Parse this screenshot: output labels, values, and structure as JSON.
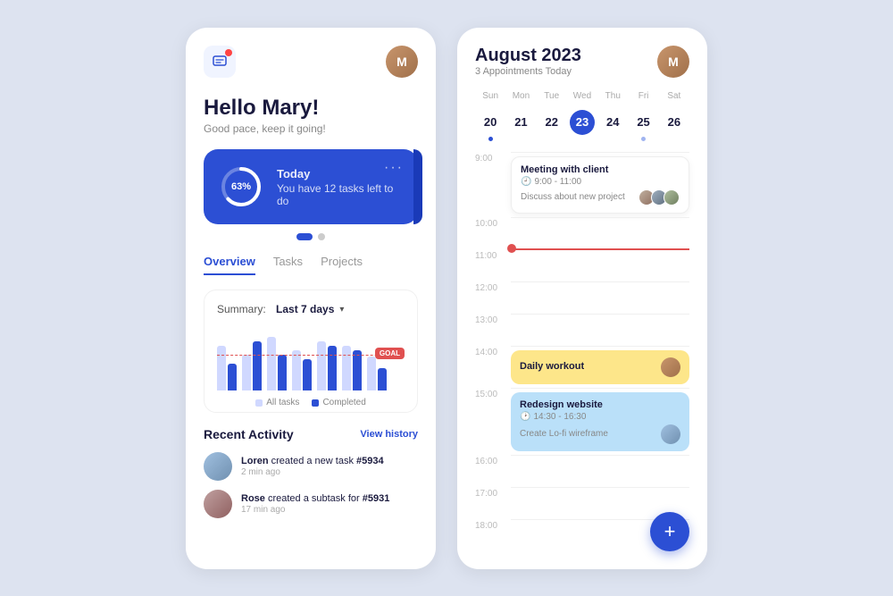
{
  "left": {
    "greeting": "Hello Mary!",
    "greeting_sub": "Good pace, keep it going!",
    "task_card": {
      "progress": 63,
      "progress_label": "63%",
      "day": "Today",
      "desc": "You have 12 tasks left to do",
      "dots_label": "..."
    },
    "tabs": [
      "Overview",
      "Tasks",
      "Projects"
    ],
    "summary": {
      "label": "Summary:",
      "period": "Last 7 days",
      "goal_label": "GOAL",
      "legend_all": "All tasks",
      "legend_completed": "Completed"
    },
    "recent": {
      "title": "Recent Activity",
      "view_history": "View history",
      "items": [
        {
          "user": "Loren",
          "action": "created a new task",
          "task": "#5934",
          "time": "2 min ago"
        },
        {
          "user": "Rose",
          "action": "created a subtask for",
          "task": "#5931",
          "time": "17 min ago"
        }
      ]
    }
  },
  "right": {
    "month": "August 2023",
    "appointments": "3 Appointments Today",
    "days": [
      "Sun",
      "Mon",
      "Tue",
      "Wed",
      "Thu",
      "Fri",
      "Sat"
    ],
    "dates": [
      {
        "num": "20",
        "dot": "blue"
      },
      {
        "num": "21",
        "dot": null
      },
      {
        "num": "22",
        "dot": null
      },
      {
        "num": "23",
        "dot": "blue",
        "today": true
      },
      {
        "num": "24",
        "dot": null
      },
      {
        "num": "25",
        "dot": "light"
      },
      {
        "num": "26",
        "dot": null
      }
    ],
    "timeline": [
      {
        "time": "9:00",
        "event": {
          "type": "white",
          "title": "Meeting with client",
          "time_range": "9:00 - 11:00",
          "desc": "Discuss about new project",
          "avatars": 3
        }
      },
      {
        "time": "10:00",
        "event": null
      },
      {
        "time": "11:00",
        "event": null
      },
      {
        "time": "12:00",
        "event": null
      },
      {
        "time": "13:00",
        "event": null
      },
      {
        "time": "14:00",
        "event": {
          "type": "yellow",
          "title": "Daily workout",
          "time_range": null,
          "avatar": "person"
        }
      },
      {
        "time": "15:00",
        "event": {
          "type": "blue",
          "title": "Redesign website",
          "time_range": "14:30 - 16:30",
          "desc": "Create Lo-fi wireframe",
          "avatar": "person2"
        }
      },
      {
        "time": "16:00",
        "event": null
      },
      {
        "time": "17:00",
        "event": null
      },
      {
        "time": "18:00",
        "event": null
      }
    ],
    "fab_label": "+"
  }
}
